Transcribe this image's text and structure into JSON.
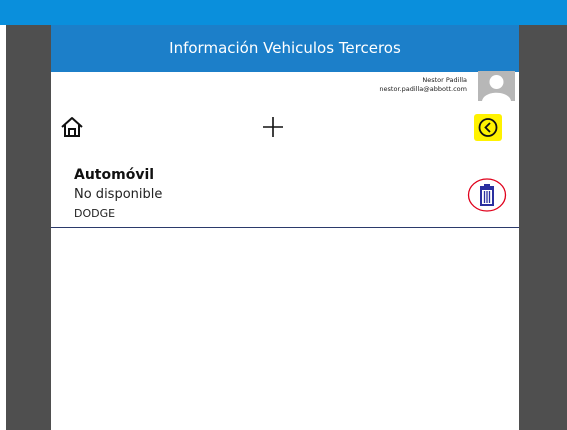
{
  "header": {
    "title": "Información Vehiculos Terceros"
  },
  "user": {
    "name": "Nestor Padilla",
    "email": "nestor.padilla@abbott.com"
  },
  "toolbar": {
    "home_icon": "home-icon",
    "add_icon": "plus-icon",
    "back_icon": "chevron-left-circle-icon",
    "back_highlight_color": "#fff200"
  },
  "vehicles": [
    {
      "type": "Automóvil",
      "status": "No disponible",
      "brand": "DODGE",
      "delete_icon": "trash-icon"
    }
  ],
  "colors": {
    "top_bar": "#0a8fdc",
    "header": "#1c7fc9",
    "side_panels": "#4f4f4f",
    "delete_icon": "#2a2fa0",
    "delete_annotation": "#e0001b"
  }
}
